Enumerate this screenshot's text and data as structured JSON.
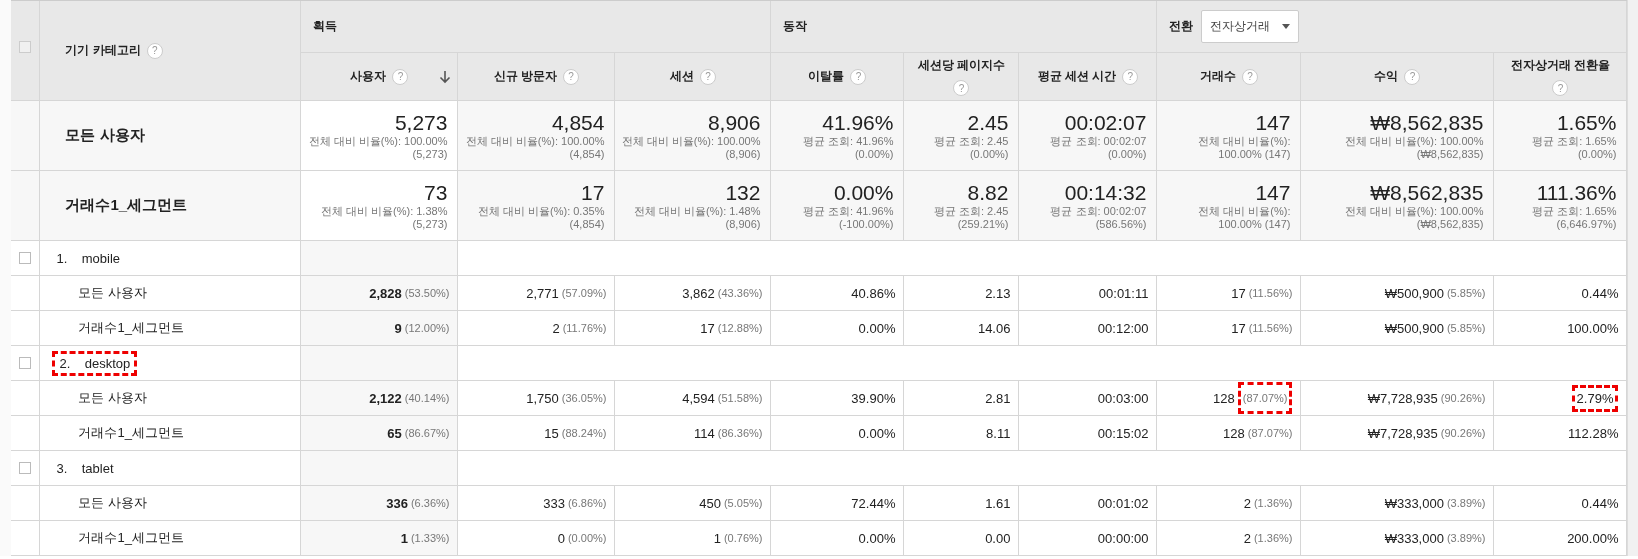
{
  "header": {
    "checked": false,
    "dimension": "기기 카테고리",
    "dimension_help": "?",
    "groups": [
      {
        "label": "획득",
        "columns": [
          {
            "label": "사용자",
            "help": "?",
            "sorted": true
          },
          {
            "label": "신규 방문자",
            "help": "?",
            "sorted": false
          },
          {
            "label": "세션",
            "help": "?",
            "sorted": false
          }
        ]
      },
      {
        "label": "동작",
        "columns": [
          {
            "label": "이탈률",
            "help": "?",
            "sorted": false
          },
          {
            "label": "세션당 페이지수",
            "help": "?",
            "sorted": false
          },
          {
            "label": "평균 세션 시간",
            "help": "?",
            "sorted": false
          }
        ]
      },
      {
        "label": "전환",
        "dropdown": "전자상거래",
        "columns": [
          {
            "label": "거래수",
            "help": "?",
            "sorted": false
          },
          {
            "label": "수익",
            "help": "?",
            "sorted": false
          },
          {
            "label": "전자상거래 전환율",
            "help": "?",
            "sorted": false
          }
        ]
      }
    ]
  },
  "summary": [
    {
      "label": "모든 사용자",
      "cells": [
        {
          "value": "5,273",
          "lines": [
            "전체 대비 비율(%): 100.00%",
            "(5,273)"
          ]
        },
        {
          "value": "4,854",
          "lines": [
            "전체 대비 비율(%): 100.00%",
            "(4,854)"
          ]
        },
        {
          "value": "8,906",
          "lines": [
            "전체 대비 비율(%): 100.00%",
            "(8,906)"
          ]
        },
        {
          "value": "41.96%",
          "lines": [
            "평균 조회: 41.96%",
            "(0.00%)"
          ]
        },
        {
          "value": "2.45",
          "lines": [
            "평균 조회: 2.45",
            "(0.00%)"
          ]
        },
        {
          "value": "00:02:07",
          "lines": [
            "평균 조회: 00:02:07",
            "(0.00%)"
          ]
        },
        {
          "value": "147",
          "lines": [
            "전체 대비 비율(%):",
            "100.00% (147)"
          ]
        },
        {
          "value": "₩8,562,835",
          "lines": [
            "전체 대비 비율(%): 100.00%",
            "(₩8,562,835)"
          ]
        },
        {
          "value": "1.65%",
          "lines": [
            "평균 조회: 1.65%",
            "(0.00%)"
          ]
        }
      ]
    },
    {
      "label": "거래수1_세그먼트",
      "cells": [
        {
          "value": "73",
          "lines": [
            "전체 대비 비율(%): 1.38%",
            "(5,273)"
          ]
        },
        {
          "value": "17",
          "lines": [
            "전체 대비 비율(%): 0.35%",
            "(4,854)"
          ]
        },
        {
          "value": "132",
          "lines": [
            "전체 대비 비율(%): 1.48%",
            "(8,906)"
          ]
        },
        {
          "value": "0.00%",
          "lines": [
            "평균 조회: 41.96%",
            "(-100.00%)"
          ]
        },
        {
          "value": "8.82",
          "lines": [
            "평균 조회: 2.45",
            "(259.21%)"
          ]
        },
        {
          "value": "00:14:32",
          "lines": [
            "평균 조회: 00:02:07",
            "(586.56%)"
          ]
        },
        {
          "value": "147",
          "lines": [
            "전체 대비 비율(%):",
            "100.00% (147)"
          ]
        },
        {
          "value": "₩8,562,835",
          "lines": [
            "전체 대비 비율(%): 100.00%",
            "(₩8,562,835)"
          ]
        },
        {
          "value": "111.36%",
          "lines": [
            "평균 조회: 1.65%",
            "(6,646.97%)"
          ]
        }
      ]
    }
  ],
  "groups": [
    {
      "index": "1.",
      "name": "mobile",
      "checked": false,
      "highlighted": false,
      "rows": [
        {
          "label": "모든 사용자",
          "cells": [
            {
              "value": "2,828",
              "pct": "(53.50%)"
            },
            {
              "value": "2,771",
              "pct": "(57.09%)"
            },
            {
              "value": "3,862",
              "pct": "(43.36%)"
            },
            {
              "value": "40.86%"
            },
            {
              "value": "2.13"
            },
            {
              "value": "00:01:11"
            },
            {
              "value": "17",
              "pct": "(11.56%)"
            },
            {
              "value": "₩500,900",
              "pct": "(5.85%)"
            },
            {
              "value": "0.44%"
            }
          ]
        },
        {
          "label": "거래수1_세그먼트",
          "cells": [
            {
              "value": "9",
              "pct": "(12.00%)"
            },
            {
              "value": "2",
              "pct": "(11.76%)"
            },
            {
              "value": "17",
              "pct": "(12.88%)"
            },
            {
              "value": "0.00%"
            },
            {
              "value": "14.06"
            },
            {
              "value": "00:12:00"
            },
            {
              "value": "17",
              "pct": "(11.56%)"
            },
            {
              "value": "₩500,900",
              "pct": "(5.85%)"
            },
            {
              "value": "100.00%"
            }
          ]
        }
      ]
    },
    {
      "index": "2.",
      "name": "desktop",
      "checked": false,
      "highlighted": true,
      "rows": [
        {
          "label": "모든 사용자",
          "cells": [
            {
              "value": "2,122",
              "pct": "(40.14%)"
            },
            {
              "value": "1,750",
              "pct": "(36.05%)"
            },
            {
              "value": "4,594",
              "pct": "(51.58%)"
            },
            {
              "value": "39.90%"
            },
            {
              "value": "2.81"
            },
            {
              "value": "00:03:00"
            },
            {
              "value": "128",
              "pct": "(87.07%)",
              "pct_highlighted": true
            },
            {
              "value": "₩7,728,935",
              "pct": "(90.26%)"
            },
            {
              "value": "2.79%",
              "value_highlighted": true
            }
          ]
        },
        {
          "label": "거래수1_세그먼트",
          "cells": [
            {
              "value": "65",
              "pct": "(86.67%)"
            },
            {
              "value": "15",
              "pct": "(88.24%)"
            },
            {
              "value": "114",
              "pct": "(86.36%)"
            },
            {
              "value": "0.00%"
            },
            {
              "value": "8.11"
            },
            {
              "value": "00:15:02"
            },
            {
              "value": "128",
              "pct": "(87.07%)"
            },
            {
              "value": "₩7,728,935",
              "pct": "(90.26%)"
            },
            {
              "value": "112.28%"
            }
          ]
        }
      ]
    },
    {
      "index": "3.",
      "name": "tablet",
      "checked": false,
      "highlighted": false,
      "rows": [
        {
          "label": "모든 사용자",
          "cells": [
            {
              "value": "336",
              "pct": "(6.36%)"
            },
            {
              "value": "333",
              "pct": "(6.86%)"
            },
            {
              "value": "450",
              "pct": "(5.05%)"
            },
            {
              "value": "72.44%"
            },
            {
              "value": "1.61"
            },
            {
              "value": "00:01:02"
            },
            {
              "value": "2",
              "pct": "(1.36%)"
            },
            {
              "value": "₩333,000",
              "pct": "(3.89%)"
            },
            {
              "value": "0.44%"
            }
          ]
        },
        {
          "label": "거래수1_세그먼트",
          "cells": [
            {
              "value": "1",
              "pct": "(1.33%)"
            },
            {
              "value": "0",
              "pct": "(0.00%)"
            },
            {
              "value": "1",
              "pct": "(0.76%)"
            },
            {
              "value": "0.00%"
            },
            {
              "value": "0.00"
            },
            {
              "value": "00:00:00"
            },
            {
              "value": "2",
              "pct": "(1.36%)"
            },
            {
              "value": "₩333,000",
              "pct": "(3.89%)"
            },
            {
              "value": "200.00%"
            }
          ]
        }
      ]
    }
  ]
}
